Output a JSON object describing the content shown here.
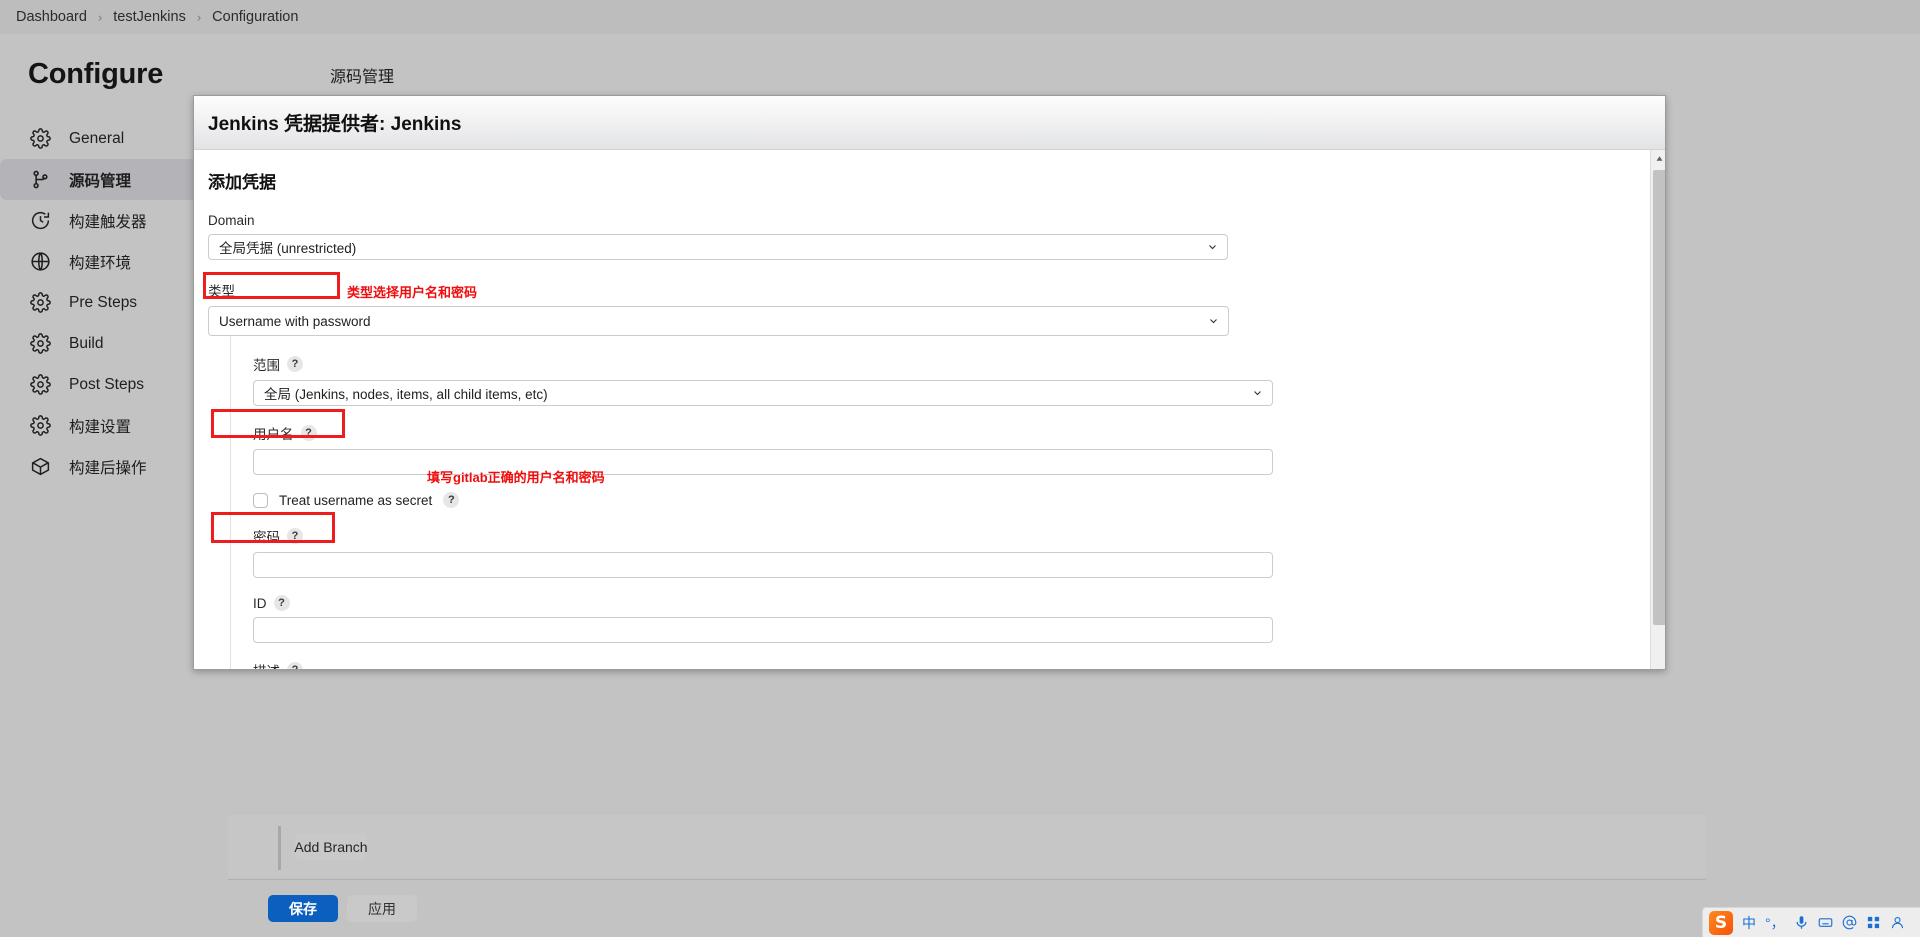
{
  "breadcrumb": {
    "items": [
      "Dashboard",
      "testJenkins",
      "Configuration"
    ],
    "separator": "›"
  },
  "page": {
    "title": "Configure",
    "scm_heading": "源码管理"
  },
  "sidebar": {
    "items": [
      {
        "label": "General",
        "icon": "gear-icon",
        "active": false
      },
      {
        "label": "源码管理",
        "icon": "branch-icon",
        "active": true
      },
      {
        "label": "构建触发器",
        "icon": "clock-icon",
        "active": false
      },
      {
        "label": "构建环境",
        "icon": "globe-icon",
        "active": false
      },
      {
        "label": "Pre Steps",
        "icon": "gear-icon",
        "active": false
      },
      {
        "label": "Build",
        "icon": "gear-icon",
        "active": false
      },
      {
        "label": "Post Steps",
        "icon": "gear-icon",
        "active": false
      },
      {
        "label": "构建设置",
        "icon": "gear-icon",
        "active": false
      },
      {
        "label": "构建后操作",
        "icon": "box-icon",
        "active": false
      }
    ]
  },
  "dialog": {
    "title": "Jenkins 凭据提供者: Jenkins",
    "section_title": "添加凭据",
    "domain": {
      "label": "Domain",
      "value": "全局凭据 (unrestricted)"
    },
    "type": {
      "label": "类型",
      "value": "Username with password"
    },
    "scope": {
      "label": "范围",
      "help": "?",
      "value": "全局 (Jenkins, nodes, items, all child items, etc)"
    },
    "username": {
      "label": "用户名",
      "help": "?",
      "value": "",
      "placeholder": ""
    },
    "treat_secret": {
      "label": "Treat username as secret",
      "help": "?",
      "checked": false
    },
    "password": {
      "label": "密码",
      "help": "?",
      "value": "",
      "placeholder": ""
    },
    "id": {
      "label": "ID",
      "help": "?",
      "value": "",
      "placeholder": ""
    },
    "description": {
      "label": "描述",
      "help": "?",
      "value": "",
      "placeholder": ""
    }
  },
  "annotations": {
    "type_note": "类型选择用户名和密码",
    "credentials_note": "填写gitlab正确的用户名和密码",
    "color": "#f10c0c"
  },
  "footer": {
    "add_branch": "Add Branch",
    "save": "保存",
    "apply": "应用",
    "save_color": "#0b5fbe"
  },
  "ime": {
    "logo": "S",
    "mode": "中",
    "punct": "°，",
    "items": [
      "mic-icon",
      "keyboard-icon",
      "at-icon",
      "apps-icon",
      "user-icon"
    ]
  }
}
